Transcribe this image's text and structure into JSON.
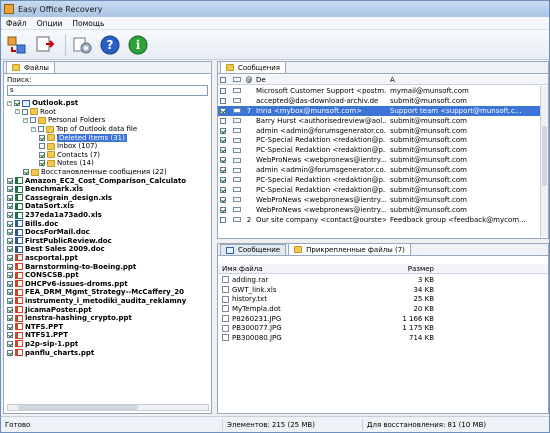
{
  "window": {
    "title": "Easy Office Recovery"
  },
  "menu": [
    "Файл",
    "Опции",
    "Помощь"
  ],
  "toolbar": {
    "buttons": [
      "recover-icon",
      "save-icon",
      "settings-icon",
      "help-icon",
      "info-icon"
    ]
  },
  "left": {
    "tab_label": "Файлы",
    "search_label": "Поиск:",
    "search_value": "s",
    "tree": [
      {
        "text": "Outlook.pst",
        "cls": "bold",
        "indent": 0,
        "icon": "file-pst",
        "cb": "checked",
        "exp": "-"
      },
      {
        "text": "Root",
        "indent": 1,
        "icon": "folder",
        "cb": "",
        "exp": "-"
      },
      {
        "text": "Personal Folders",
        "indent": 2,
        "icon": "folder",
        "cb": "",
        "exp": "-"
      },
      {
        "text": "Top of Outlook data file",
        "indent": 3,
        "icon": "folder",
        "cb": "",
        "exp": "-"
      },
      {
        "text": "Deleted Items (31)",
        "indent": 4,
        "icon": "folder",
        "cb": "checked",
        "sel": true
      },
      {
        "text": "Inbox (107)",
        "indent": 4,
        "icon": "folder",
        "cb": "",
        "blue": "(107)"
      },
      {
        "text": "Contacts (7)",
        "indent": 4,
        "icon": "folder",
        "cb": "checked",
        "blue": "(7)"
      },
      {
        "text": "Notes (14)",
        "indent": 4,
        "icon": "folder",
        "cb": "checked",
        "blue": "(14)"
      },
      {
        "text": "Восстановленные сообщения (22)",
        "indent": 2,
        "icon": "folder",
        "cb": "checked",
        "blue": "(22)"
      },
      {
        "text": "Amazon_EC2_Cost_Comparison_Calculato",
        "cls": "bold",
        "indent": 0,
        "icon": "file-xls",
        "cb": "checked"
      },
      {
        "text": "Benchmark.xls",
        "cls": "bold",
        "indent": 0,
        "icon": "file-xls",
        "cb": "checked"
      },
      {
        "text": "Cassegrain_design.xls",
        "cls": "bold",
        "indent": 0,
        "icon": "file-xls",
        "cb": "checked"
      },
      {
        "text": "DataSort.xls",
        "cls": "bold",
        "indent": 0,
        "icon": "file-xls",
        "cb": "checked"
      },
      {
        "text": "237eda1a73ad0.xls",
        "cls": "bold",
        "indent": 0,
        "icon": "file-xls",
        "cb": "checked"
      },
      {
        "text": "Bills.doc",
        "cls": "bold",
        "indent": 0,
        "icon": "file-doc",
        "cb": "checked"
      },
      {
        "text": "DocsForMail.doc",
        "cls": "bold",
        "indent": 0,
        "icon": "file-doc",
        "cb": "checked"
      },
      {
        "text": "FirstPublicReview.doc",
        "cls": "bold",
        "indent": 0,
        "icon": "file-doc",
        "cb": "checked"
      },
      {
        "text": "Best Sales 2009.doc",
        "cls": "bold",
        "indent": 0,
        "icon": "file-doc",
        "cb": "checked"
      },
      {
        "text": "ascportal.ppt",
        "cls": "bold",
        "indent": 0,
        "icon": "file-ppt",
        "cb": "checked"
      },
      {
        "text": "Barnstorming-to-Boeing.ppt",
        "cls": "bold",
        "indent": 0,
        "icon": "file-ppt",
        "cb": "checked"
      },
      {
        "text": "CONSCSB.ppt",
        "cls": "bold",
        "indent": 0,
        "icon": "file-ppt",
        "cb": "checked"
      },
      {
        "text": "DHCPv6-issues-droms.ppt",
        "cls": "bold",
        "indent": 0,
        "icon": "file-ppt",
        "cb": "checked"
      },
      {
        "text": "FEA_DRM_Mgmt_Strategy--McCaffery_20",
        "cls": "bold",
        "indent": 0,
        "icon": "file-ppt",
        "cb": "checked"
      },
      {
        "text": "instrumenty_i_metodiki_audita_reklamny",
        "cls": "bold",
        "indent": 0,
        "icon": "file-ppt",
        "cb": "checked"
      },
      {
        "text": "JicamaPoster.ppt",
        "cls": "bold",
        "indent": 0,
        "icon": "file-ppt",
        "cb": "checked"
      },
      {
        "text": "lenstra-hashing_crypto.ppt",
        "cls": "bold",
        "indent": 0,
        "icon": "file-ppt",
        "cb": "checked"
      },
      {
        "text": "NTFS.PPT",
        "cls": "bold",
        "indent": 0,
        "icon": "file-ppt",
        "cb": "checked"
      },
      {
        "text": "NTFS1.PPT",
        "cls": "bold",
        "indent": 0,
        "icon": "file-ppt",
        "cb": "checked"
      },
      {
        "text": "p2p-sip-1.ppt",
        "cls": "bold",
        "indent": 0,
        "icon": "file-ppt",
        "cb": "checked"
      },
      {
        "text": "panflu_charts.ppt",
        "cls": "bold",
        "indent": 0,
        "icon": "file-ppt",
        "cb": "checked"
      }
    ]
  },
  "messages": {
    "tab_label": "Сообщения",
    "col_from": "De",
    "col_to": "A",
    "rows": [
      {
        "cb": "",
        "att": "",
        "from": "Microsoft Customer Support <postm...",
        "to": "mymail@munsoft.com"
      },
      {
        "cb": "",
        "att": "",
        "from": "accepted@das-download-archiv.de",
        "to": "submit@munsoft.com"
      },
      {
        "cb": "checked",
        "att": "7",
        "from": "Irina <mybox@munsoft.com>",
        "to": "Support team <support@munsoft.c...",
        "sel": true
      },
      {
        "cb": "",
        "att": "",
        "from": "Barry Hurst <authorisedreview@aol....",
        "to": "submit@munsoft.com"
      },
      {
        "cb": "checked",
        "att": "",
        "from": "admin <admin@forumsgenerator.co...",
        "to": "submit@munsoft.com"
      },
      {
        "cb": "checked",
        "att": "",
        "from": "PC-Special Redaktion <redaktion@p...",
        "to": "submit@munsoft.com"
      },
      {
        "cb": "checked",
        "att": "",
        "from": "PC-Special Redaktion <redaktion@p...",
        "to": "submit@munsoft.com"
      },
      {
        "cb": "checked",
        "att": "",
        "from": "WebProNews <webpronews@ientry....",
        "to": "submit@munsoft.com"
      },
      {
        "cb": "checked",
        "att": "",
        "from": "admin <admin@forumsgenerator.co...",
        "to": "submit@munsoft.com"
      },
      {
        "cb": "checked",
        "att": "",
        "from": "PC-Special Redaktion <redaktion@p...",
        "to": "submit@munsoft.com"
      },
      {
        "cb": "checked",
        "att": "",
        "from": "PC-Special Redaktion <redaktion@p...",
        "to": "submit@munsoft.com"
      },
      {
        "cb": "checked",
        "att": "",
        "from": "WebProNews <webpronews@ientry....",
        "to": "submit@munsoft.com"
      },
      {
        "cb": "checked",
        "att": "",
        "from": "WebProNews <webpronews@ientry....",
        "to": "submit@munsoft.com"
      },
      {
        "cb": "",
        "att": "2",
        "from": "Our site company <contact@ourste>",
        "to": "Feedback group <feedback@mycom..."
      }
    ]
  },
  "bottom": {
    "tab_message": "Сообщение",
    "tab_attachments": "Прикрепленные файлы (7)",
    "col_name": "Имя файла",
    "col_size": "Размер",
    "files": [
      {
        "name": "adding.rar",
        "size": "3 KB"
      },
      {
        "name": "GWT_link.xls",
        "size": "34 KB"
      },
      {
        "name": "history.txt",
        "size": "25 KB"
      },
      {
        "name": "MyTempla.dot",
        "size": "20 KB"
      },
      {
        "name": "P8260231.JPG",
        "size": "1 166 KB"
      },
      {
        "name": "PB300077.JPG",
        "size": "1 175 KB"
      },
      {
        "name": "PB300080.JPG",
        "size": "714 KB"
      }
    ]
  },
  "status": {
    "ready": "Готово",
    "elements": "Элементов: 215 (25 MB)",
    "to_recover": "Для восстановления: 81 (10 MB)"
  }
}
